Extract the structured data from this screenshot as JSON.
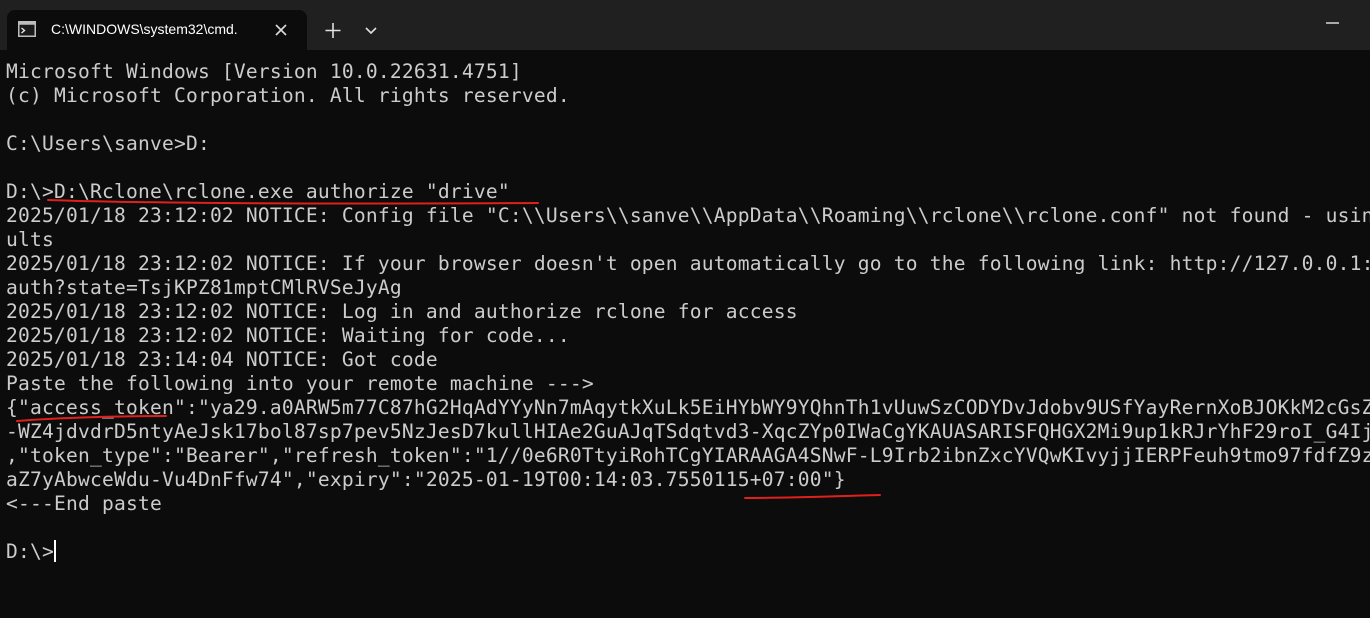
{
  "window": {
    "tab_title": "C:\\WINDOWS\\system32\\cmd.",
    "icons": {
      "tab": "terminal-icon",
      "close": "close-icon",
      "new_tab": "plus-icon",
      "dropdown": "chevron-down-icon",
      "minimize": "minimize-icon"
    }
  },
  "terminal": {
    "lines": [
      "Microsoft Windows [Version 10.0.22631.4751]",
      "(c) Microsoft Corporation. All rights reserved.",
      "",
      "C:\\Users\\sanve>D:",
      "",
      "D:\\>D:\\Rclone\\rclone.exe authorize \"drive\"",
      "2025/01/18 23:12:02 NOTICE: Config file \"C:\\\\Users\\\\sanve\\\\AppData\\\\Roaming\\\\rclone\\\\rclone.conf\" not found - usin",
      "ults",
      "2025/01/18 23:12:02 NOTICE: If your browser doesn't open automatically go to the following link: http://127.0.0.1:",
      "auth?state=TsjKPZ81mptCMlRVSeJyAg",
      "2025/01/18 23:12:02 NOTICE: Log in and authorize rclone for access",
      "2025/01/18 23:12:02 NOTICE: Waiting for code...",
      "2025/01/18 23:14:04 NOTICE: Got code",
      "Paste the following into your remote machine --->",
      "{\"access_token\":\"ya29.a0ARW5m77C87hG2HqAdYYyNn7mAqytkXuLk5EiHYbWY9YQhnTh1vUuwSzCODYDvJdobv9USfYayRernXoBJOKkM2cGsZ",
      "-WZ4jdvdrD5ntyAeJsk17bol87sp7pev5NzJesD7kullHIAe2GuAJqTSdqtvd3-XqcZYp0IWaCgYKAUASARISFQHGX2Mi9up1kRJrYhF29roI_G4Ij",
      ",\"token_type\":\"Bearer\",\"refresh_token\":\"1//0e6R0TtyiRohTCgYIARAAGA4SNwF-L9Irb2ibnZxcYVQwKIvyjjIERPFeuh9tmo97fdfZ9z",
      "aZ7yAbwceWdu-Vu4DnFfw74\",\"expiry\":\"2025-01-19T00:14:03.7550115+07:00\"}",
      "<---End paste",
      "",
      "D:\\>"
    ]
  },
  "colors": {
    "background": "#0c0c0c",
    "titlebar": "#202020",
    "text": "#cccccc",
    "annotation": "#e0201c"
  }
}
